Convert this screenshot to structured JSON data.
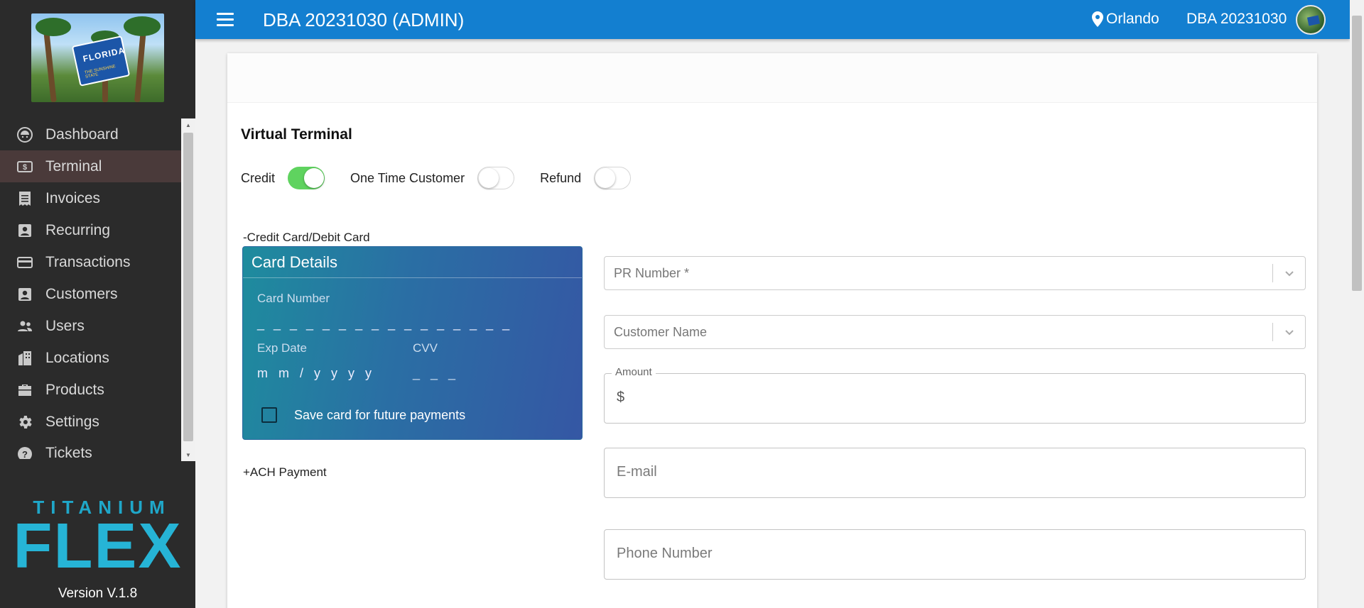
{
  "app": {
    "title": "DBA 20231030 (ADMIN)",
    "location": "Orlando",
    "user": "DBA 20231030",
    "version": "Version V.1.8",
    "brand_top": "TITANIUM",
    "brand_main": "FLEX",
    "logo_sign_text": "FLORIDA",
    "logo_sign_sub": "THE SUNSHINE STATE"
  },
  "sidebar": {
    "items": [
      {
        "label": "Dashboard",
        "icon": "dashboard-icon"
      },
      {
        "label": "Terminal",
        "icon": "terminal-icon",
        "active": true
      },
      {
        "label": "Invoices",
        "icon": "invoice-icon"
      },
      {
        "label": "Recurring",
        "icon": "recurring-icon"
      },
      {
        "label": "Transactions",
        "icon": "credit-card-icon"
      },
      {
        "label": "Customers",
        "icon": "customer-icon"
      },
      {
        "label": "Users",
        "icon": "users-icon"
      },
      {
        "label": "Locations",
        "icon": "building-icon"
      },
      {
        "label": "Products",
        "icon": "briefcase-icon"
      },
      {
        "label": "Settings",
        "icon": "gear-icon"
      },
      {
        "label": "Tickets",
        "icon": "help-icon"
      }
    ]
  },
  "main": {
    "title": "Virtual Terminal",
    "toggles": [
      {
        "label": "Credit",
        "on": true
      },
      {
        "label": "One Time Customer",
        "on": false
      },
      {
        "label": "Refund",
        "on": false
      }
    ],
    "credit_section_label": "-Credit Card/Debit Card",
    "ach_section_label": "+ACH Payment",
    "card": {
      "title": "Card Details",
      "number_label": "Card Number",
      "number_mask": "_ _ _ _ _ _ _ _ _ _ _ _ _ _ _ _",
      "exp_label": "Exp Date",
      "exp_mask": "m m / y y y y",
      "cvv_label": "CVV",
      "cvv_mask": "_ _ _",
      "save_label": "Save card for future payments"
    },
    "form": {
      "pr_number_placeholder": "PR Number *",
      "customer_name_placeholder": "Customer Name",
      "amount_label": "Amount",
      "amount_prefix": "$",
      "email_placeholder": "E-mail",
      "phone_placeholder": "Phone Number"
    }
  },
  "colors": {
    "header": "#137fd0",
    "sidebar": "#2b2b2b",
    "toggle_on": "#5fd35f",
    "brand": "#26b4d6"
  }
}
